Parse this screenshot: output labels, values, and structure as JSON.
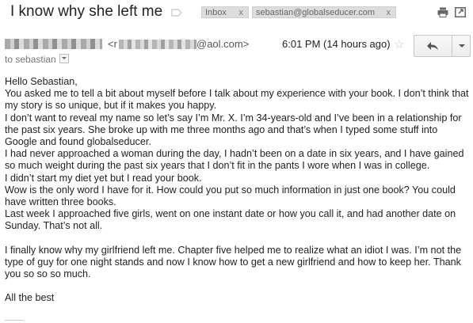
{
  "subject": "I know why she left me",
  "labels": [
    {
      "text": "Inbox",
      "close": "x"
    },
    {
      "text": "sebastian@globalseducer.com",
      "close": "x"
    }
  ],
  "icons": {
    "label": "label-tag-icon",
    "print": "print-icon",
    "popout": "open-in-new-window-icon",
    "star": "star-icon",
    "reply": "reply-icon",
    "more": "chevron-down-icon"
  },
  "sender": {
    "email_prefix": "<r",
    "email_domain": "@aol.com>",
    "time": "6:01 PM (14 hours ago)",
    "star_glyph": "☆"
  },
  "to_line": "to sebastian",
  "body": [
    "Hello Sebastian,",
    "You asked me to tell a bit about myself before I talk about my experience with your book. I don’t think that my story is so unique, but if it makes you happy.",
    "I don’t want to reveal my name so let’s say I’m Mr. X. I’m 34-years-old and I’ve been in a relationship for the past six years. She broke up with me three months ago and that’s when I typed some stuff into Google and found globalseducer.",
    "I had never approached a woman during the day, I hadn’t been on a date in six years, and I have gained so much weight during the past six years that I don’t fit in the pants I wore when I was in college.",
    "I didn’t start my diet yet but I read your book.",
    "Wow is the only word I have for it. How could you put so much information in just one book? You could have written three books.",
    "Last week I approached five girls, went on one instant date or how you call it, and had another date on Sunday. That’s not all.",
    "",
    "I finally know why my girlfriend left me. Chapter five helped me to realize what an idiot I was. I’m not the type of guy for one night stands and now I know how to get a new girlfriend and how to keep her. Thank you so so so much.",
    "",
    "All the best"
  ]
}
